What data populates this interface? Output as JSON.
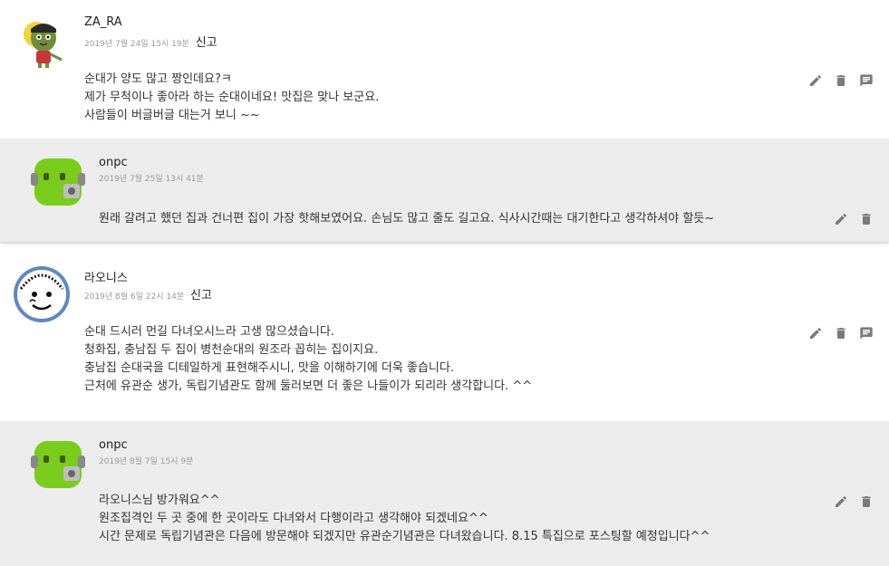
{
  "comments": [
    {
      "author": "ZA_RA",
      "date": "2019년 7월 24일 15시 19분",
      "report_label": "신고",
      "lines": [
        "순대가 양도 많고 짱인데요?ㅋ",
        "제가 무척이나 좋아라 하는 순대이네요! 맛집은 맞나 보군요.",
        "사람들이 버글버글 대는거 보니 ~~"
      ],
      "reply": {
        "author": "onpc",
        "date": "2019년 7월 25일 13시 41분",
        "lines": [
          "원래 갈려고 했던 집과 건너편 집이 가장 핫해보였어요. 손님도 많고 줄도 길고요. 식사시간때는 대기한다고 생각하셔야 할듯~"
        ]
      }
    },
    {
      "author": "라오니스",
      "date": "2019년 8월 6일 22시 14분",
      "report_label": "신고",
      "lines": [
        "순대 드시러 먼길 다녀오시느라 고생 많으셨습니다.",
        "청화집, 충남집 두 집이 병천순대의 원조라 꼽히는 집이지요.",
        "충남집 순대국을 디테일하게 표현해주시니, 맛을 이해하기에 더욱 좋습니다.",
        "근처에 유관순 생가, 독립기념관도 함께 둘러보면 더 좋은 나들이가 되리라 생각합니다. ^^"
      ],
      "reply": {
        "author": "onpc",
        "date": "2019년 8월 7일 15시 9분",
        "lines": [
          "라오니스님 방가워요^^",
          "원조집격인 두 곳 중에 한 곳이라도 다녀와서 다행이라고 생각해야 되겠네요^^",
          "시간 문제로 독립기념관은 다음에 방문해야 되겠지만 유관순기념관은 다녀왔습니다. 8.15 특집으로 포스팅할 예정입니다^^"
        ]
      }
    }
  ],
  "icons": {
    "edit": "pencil-icon",
    "delete": "trash-icon",
    "reply": "comment-icon"
  },
  "colors": {
    "reply_bg": "#ececec",
    "icon": "#7a7a7a",
    "meta": "#9a9a9a"
  }
}
